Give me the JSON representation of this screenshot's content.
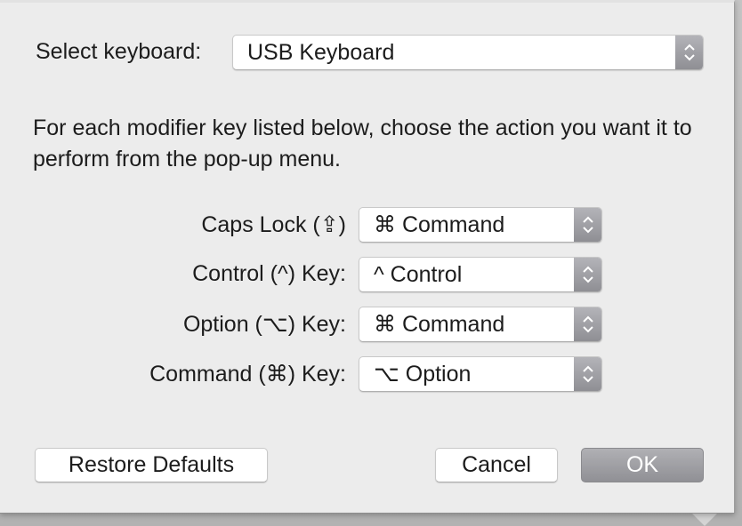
{
  "dialog": {
    "select_keyboard_label": "Select keyboard:",
    "keyboard_value": "USB Keyboard",
    "intro_text": "For each modifier key listed below, choose the action you want it to perform from the pop-up menu.",
    "modifiers": [
      {
        "label": "Caps Lock (⇪)",
        "value": "⌘ Command"
      },
      {
        "label": "Control (^) Key:",
        "value": "^ Control"
      },
      {
        "label": "Option (⌥) Key:",
        "value": "⌘ Command"
      },
      {
        "label": "Command (⌘) Key:",
        "value": "⌥ Option"
      }
    ],
    "buttons": {
      "restore_defaults": "Restore Defaults",
      "cancel": "Cancel",
      "ok": "OK"
    }
  },
  "icons": {
    "popup_stepper": "chevron-up-down-icon"
  },
  "colors": {
    "sheet_background": "#ececec",
    "stepper_gray": "#a0a0a5",
    "default_button_gray": "#9e9ea3"
  }
}
